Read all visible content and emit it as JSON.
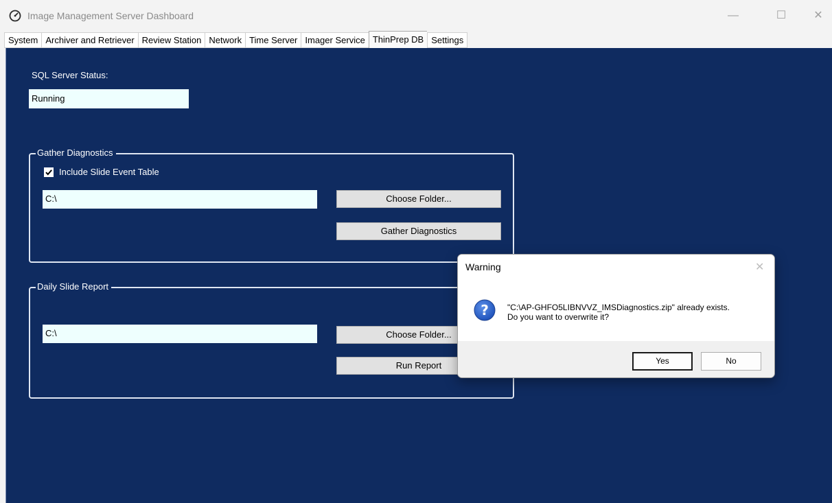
{
  "window": {
    "title": "Image Management Server Dashboard",
    "app_icon": "gauge-icon",
    "controls": {
      "minimize": "—",
      "maximize": "☐",
      "close": "✕"
    }
  },
  "tabs": [
    {
      "label": "System",
      "active": false
    },
    {
      "label": "Archiver and Retriever",
      "active": false
    },
    {
      "label": "Review Station",
      "active": false
    },
    {
      "label": "Network",
      "active": false
    },
    {
      "label": "Time Server",
      "active": false
    },
    {
      "label": "Imager Service",
      "active": false
    },
    {
      "label": "ThinPrep DB",
      "active": true
    },
    {
      "label": "Settings",
      "active": false
    }
  ],
  "sql": {
    "label": "SQL Server Status:",
    "value": "Running"
  },
  "gather": {
    "title": "Gather Diagnostics",
    "include_label": "Include Slide Event Table",
    "include_checked": true,
    "path": "C:\\",
    "choose_label": "Choose Folder...",
    "gather_label": "Gather Diagnostics"
  },
  "daily": {
    "title": "Daily Slide Report",
    "path": "C:\\",
    "choose_label": "Choose Folder...",
    "run_label": "Run Report"
  },
  "dialog": {
    "title": "Warning",
    "close": "✕",
    "icon": "question-icon",
    "message_line1": "\"C:\\AP-GHFO5LIBNVVZ_IMSDiagnostics.zip\" already exists.",
    "message_line2": "Do you want to overwrite it?",
    "yes_label": "Yes",
    "no_label": "No"
  },
  "colors": {
    "panel_background": "#0f2b60",
    "field_background": "#eefffe",
    "button_background": "#e1e1e1"
  }
}
